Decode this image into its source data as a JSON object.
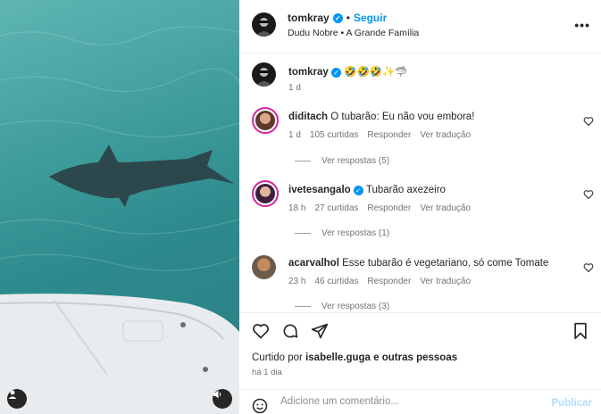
{
  "post": {
    "username": "tomkray",
    "follow_label": "Seguir",
    "audio": "Dudu Nobre • A Grande Família",
    "more_label": "•••"
  },
  "caption": {
    "username": "tomkray",
    "text": "🤣🤣🤣✨🦈",
    "time": "1 d"
  },
  "comments": [
    {
      "username": "diditach",
      "text": "O tubarão: Eu não vou embora!",
      "time": "1 d",
      "likes": "105 curtidas",
      "reply_label": "Responder",
      "translate_label": "Ver tradução",
      "replies": "Ver respostas (5)",
      "verified": false
    },
    {
      "username": "ivetesangalo",
      "text": "Tubarão axezeiro",
      "time": "18 h",
      "likes": "27 curtidas",
      "reply_label": "Responder",
      "translate_label": "Ver tradução",
      "replies": "Ver respostas (1)",
      "verified": true
    },
    {
      "username": "acarvalhol",
      "text": "Esse tubarão é vegetariano, só come Tomate",
      "time": "23 h",
      "likes": "46 curtidas",
      "reply_label": "Responder",
      "translate_label": "Ver tradução",
      "replies": "Ver respostas (3)",
      "verified": false
    }
  ],
  "likes_summary": {
    "prefix": "Curtido por",
    "user": "isabelle.guga",
    "suffix": "e outras pessoas"
  },
  "posted_ago": "há 1 dia",
  "add_comment": {
    "placeholder": "Adicione um comentário...",
    "publish_label": "Publicar"
  },
  "icons": {
    "media": [
      "user-tag-icon",
      "sound-icon"
    ],
    "actions": [
      "heart-icon",
      "comment-icon",
      "share-icon",
      "bookmark-icon"
    ],
    "composer": [
      "emoji-icon"
    ]
  },
  "colors": {
    "accent": "#0095f6",
    "publish_disabled": "#b3dbff",
    "muted": "#737373"
  }
}
